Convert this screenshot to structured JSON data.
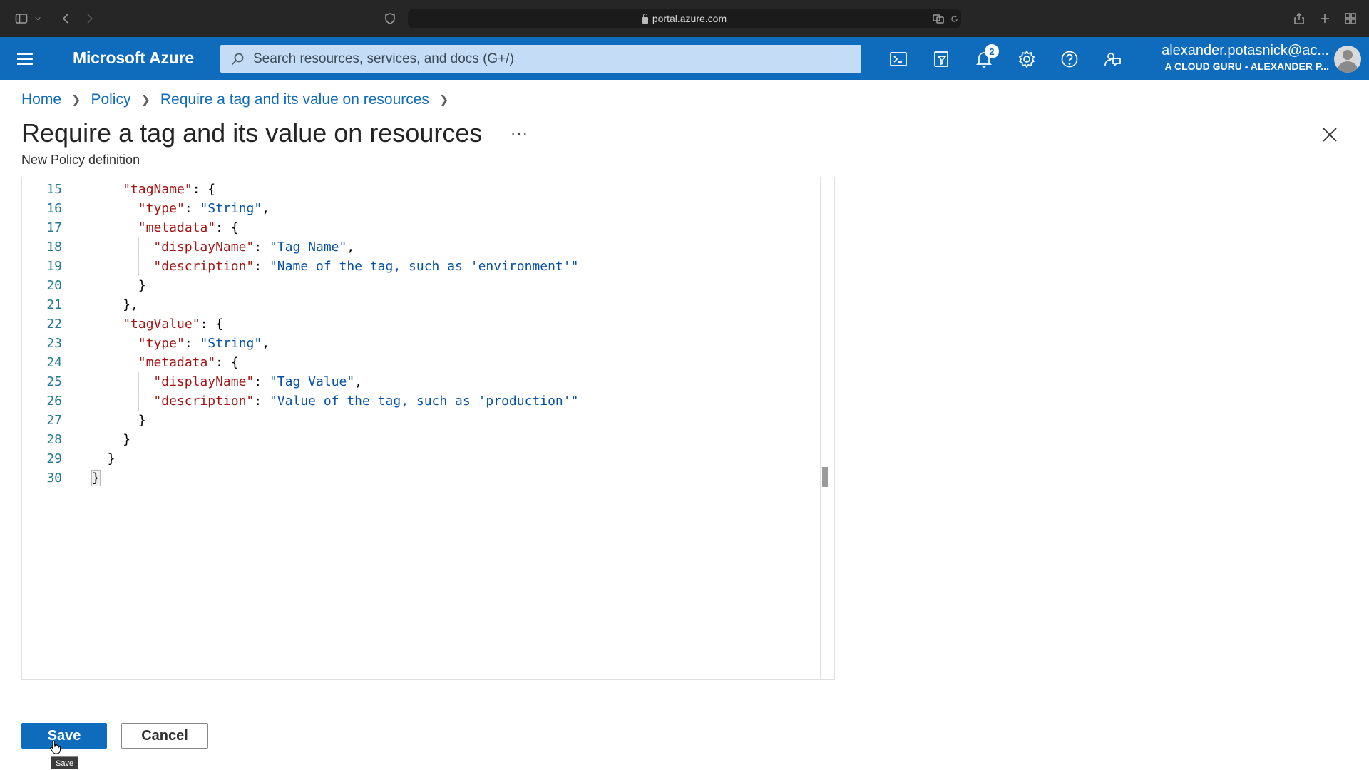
{
  "browser": {
    "url": "portal.azure.com"
  },
  "topbar": {
    "brand": "Microsoft Azure",
    "search_placeholder": "Search resources, services, and docs (G+/)",
    "notification_count": "2",
    "account_email": "alexander.potasnick@ac...",
    "account_directory": "A CLOUD GURU - ALEXANDER P...",
    "icons": [
      "cloud-shell-icon",
      "directory-filter-icon",
      "bell-icon",
      "gear-icon",
      "help-icon",
      "feedback-icon"
    ]
  },
  "breadcrumb": {
    "items": [
      "Home",
      "Policy",
      "Require a tag and its value on resources"
    ]
  },
  "page": {
    "title": "Require a tag and its value on resources",
    "more": "···",
    "subtitle": "New Policy definition"
  },
  "editor": {
    "lines": [
      {
        "n": "15",
        "indent": 2,
        "text": "\"tagName\": {"
      },
      {
        "n": "16",
        "indent": 3,
        "text": "\"type\": \"String\","
      },
      {
        "n": "17",
        "indent": 3,
        "text": "\"metadata\": {"
      },
      {
        "n": "18",
        "indent": 4,
        "text": "\"displayName\": \"Tag Name\","
      },
      {
        "n": "19",
        "indent": 4,
        "text": "\"description\": \"Name of the tag, such as 'environment'\""
      },
      {
        "n": "20",
        "indent": 3,
        "text": "}"
      },
      {
        "n": "21",
        "indent": 2,
        "text": "},"
      },
      {
        "n": "22",
        "indent": 2,
        "text": "\"tagValue\": {"
      },
      {
        "n": "23",
        "indent": 3,
        "text": "\"type\": \"String\","
      },
      {
        "n": "24",
        "indent": 3,
        "text": "\"metadata\": {"
      },
      {
        "n": "25",
        "indent": 4,
        "text": "\"displayName\": \"Tag Value\","
      },
      {
        "n": "26",
        "indent": 4,
        "text": "\"description\": \"Value of the tag, such as 'production'\""
      },
      {
        "n": "27",
        "indent": 3,
        "text": "}"
      },
      {
        "n": "28",
        "indent": 2,
        "text": "}"
      },
      {
        "n": "29",
        "indent": 1,
        "text": "}"
      },
      {
        "n": "30",
        "indent": 0,
        "text": "}"
      }
    ]
  },
  "actions": {
    "save_label": "Save",
    "cancel_label": "Cancel",
    "tooltip": "Save"
  },
  "colors": {
    "azure_blue": "#0f6cbd",
    "json_key": "#a31515",
    "json_string": "#0451a5",
    "line_number": "#237893"
  }
}
